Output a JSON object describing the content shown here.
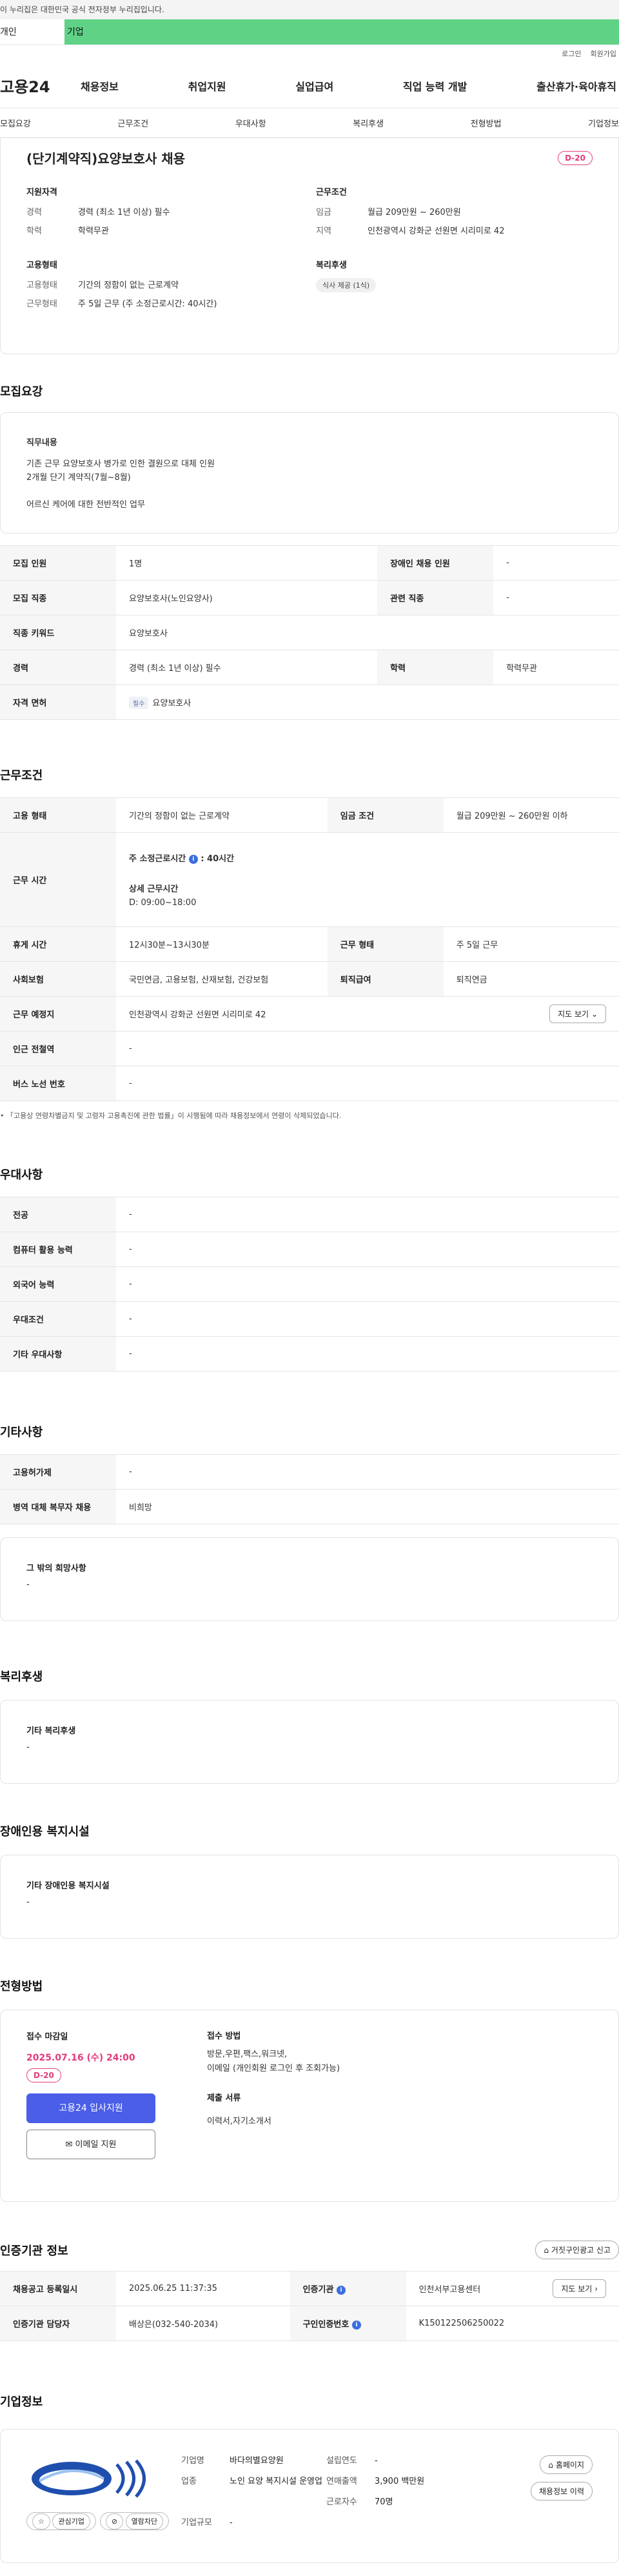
{
  "gov_banner": "이 누리집은 대한민국 공식 전자정부 누리집입니다.",
  "top_tabs": {
    "personal": "개인",
    "company": "기업"
  },
  "util": {
    "login": "로그인",
    "join": "회원가입"
  },
  "logo": "고용24",
  "gnb": [
    "채용정보",
    "취업지원",
    "실업급여",
    "직업 능력 개발",
    "출산휴가·육아휴직"
  ],
  "subnav": [
    "모집요강",
    "근무조건",
    "우대사항",
    "복리후생",
    "전형방법",
    "기업정보"
  ],
  "summary": {
    "title": "(단기계약직)요양보호사 채용",
    "dday": "D-20",
    "qual_title": "지원자격",
    "qual": [
      {
        "k": "경력",
        "v": "경력 (최소 1년 이상) 필수"
      },
      {
        "k": "학력",
        "v": "학력무관"
      }
    ],
    "cond_title": "근무조건",
    "cond": [
      {
        "k": "임금",
        "v": "월급 209만원 ~ 260만원"
      },
      {
        "k": "지역",
        "v": "인천광역시 강화군 선원면 시리미로 42"
      }
    ],
    "emp_title": "고용형태",
    "emp": [
      {
        "k": "고용형태",
        "v": "기간의 정함이 없는 근로계약"
      },
      {
        "k": "근무형태",
        "v": "주 5일 근무 (주 소정근로시간: 40시간)"
      }
    ],
    "welfare_title": "복리후생",
    "welfare_chip": "식사 제공 (1식)"
  },
  "recruit": {
    "title": "모집요강",
    "duty_title": "직무내용",
    "duty_lines": [
      "기존 근무 요양보호사 병가로 인한 결원으로 대체 인원",
      "2개월 단기 계약직(7월~8월)",
      "",
      "어르신 케어에 대한 전반적인 업무"
    ],
    "rows": [
      {
        "k1": "모집 인원",
        "v1": "1명",
        "k2": "장애인 채용 인원",
        "v2": "-"
      },
      {
        "k1": "모집 직종",
        "v1": "요양보호사(노인요양사)",
        "k2": "관련 직종",
        "v2": "-"
      },
      {
        "k1": "직종 키워드",
        "v1": "요양보호사",
        "k2": "",
        "v2": ""
      },
      {
        "k1": "경력",
        "v1": "경력 (최소 1년 이상) 필수",
        "k2": "학력",
        "v2": "학력무관"
      }
    ],
    "license_k": "자격 면허",
    "license_badge": "필수",
    "license_v": "요양보호사"
  },
  "work": {
    "title": "근무조건",
    "emp_k": "고용 형태",
    "emp_v": "기간의 정함이 없는 근로계약",
    "wage_k": "임금 조건",
    "wage_v": "월급 209만원 ~ 260만원 이하",
    "time_k": "근무 시간",
    "time_std": "주 소정근로시간",
    "time_std_v": ": 40시간",
    "time_detail_title": "상세 근무시간",
    "time_detail_v": "D: 09:00~18:00",
    "break_k": "휴게 시간",
    "break_v": "12시30분~13시30분",
    "form_k": "근무 형태",
    "form_v": "주 5일 근무",
    "ins_k": "사회보험",
    "ins_v": "국민연금, 고용보험, 산재보험, 건강보험",
    "ret_k": "퇴직급여",
    "ret_v": "퇴직연금",
    "place_k": "근무 예정지",
    "place_v": "인천광역시 강화군 선원면 시리미로 42",
    "map_btn": "지도 보기",
    "subway_k": "인근 전철역",
    "subway_v": "-",
    "bus_k": "버스 노선 번호",
    "bus_v": "-",
    "note": "「고용상 연령차별금지 및 고령자 고용촉진에 관한 법률」이 시행됨에 따라 채용정보에서 연령이 삭제되었습니다."
  },
  "pref": {
    "title": "우대사항",
    "rows": [
      {
        "k": "전공",
        "v": "-"
      },
      {
        "k": "컴퓨터 활용 능력",
        "v": "-"
      },
      {
        "k": "외국어 능력",
        "v": "-"
      },
      {
        "k": "우대조건",
        "v": "-"
      },
      {
        "k": "기타 우대사항",
        "v": "-"
      }
    ]
  },
  "etc": {
    "title": "기타사항",
    "rows": [
      {
        "k": "고용허가제",
        "v": "-"
      },
      {
        "k": "병역 대체 복무자 채용",
        "v": "비희망"
      }
    ],
    "wish_title": "그 밖의 희망사항",
    "wish_v": "-"
  },
  "welfare": {
    "title": "복리후생",
    "box_title": "기타 복리후생",
    "box_v": "-"
  },
  "disabled": {
    "title": "장애인용 복지시설",
    "box_title": "기타 장애인용 복지시설",
    "box_v": "-"
  },
  "select": {
    "title": "전형방법",
    "deadline_title": "접수 마감일",
    "deadline": "2025.07.16 (수) 24:00",
    "dday": "D-20",
    "apply_btn": "고용24 입사지원",
    "email_btn": "이메일 지원",
    "method_title": "접수 방법",
    "method_lines": [
      "방문,우편,팩스,워크넷,",
      "이메일 (개인회원 로그인 후 조회가능)"
    ],
    "docs_title": "제출 서류",
    "docs_v": "이력서,자기소개서"
  },
  "agency": {
    "title": "인증기관 정보",
    "report_btn": "거짓구인광고 신고",
    "reg_k": "채용공고 등록일시",
    "reg_v": "2025.06.25 11:37:35",
    "cert_k": "인증기관",
    "cert_v": "인천서부고용센터",
    "map_btn": "지도 보기",
    "manager_k": "인증기관 담당자",
    "manager_v": "배상은(032-540-2034)",
    "no_k": "구인인증번호",
    "no_v": "K150122506250022"
  },
  "company": {
    "title": "기업정보",
    "interest_btn": "관심기업",
    "block_btn": "열람차단",
    "name_k": "기업명",
    "name_v": "바다의별요양원",
    "est_k": "설립연도",
    "est_v": "-",
    "biz_k": "업종",
    "biz_v": "노인 요양 복지시설 운영업",
    "sales_k": "연매출액",
    "sales_v": "3,900 백만원",
    "emp_k": "근로자수",
    "emp_v": "70명",
    "size_k": "기업규모",
    "size_v": "-",
    "home_btn": "홈페이지",
    "history_btn": "채용정보 이력"
  }
}
